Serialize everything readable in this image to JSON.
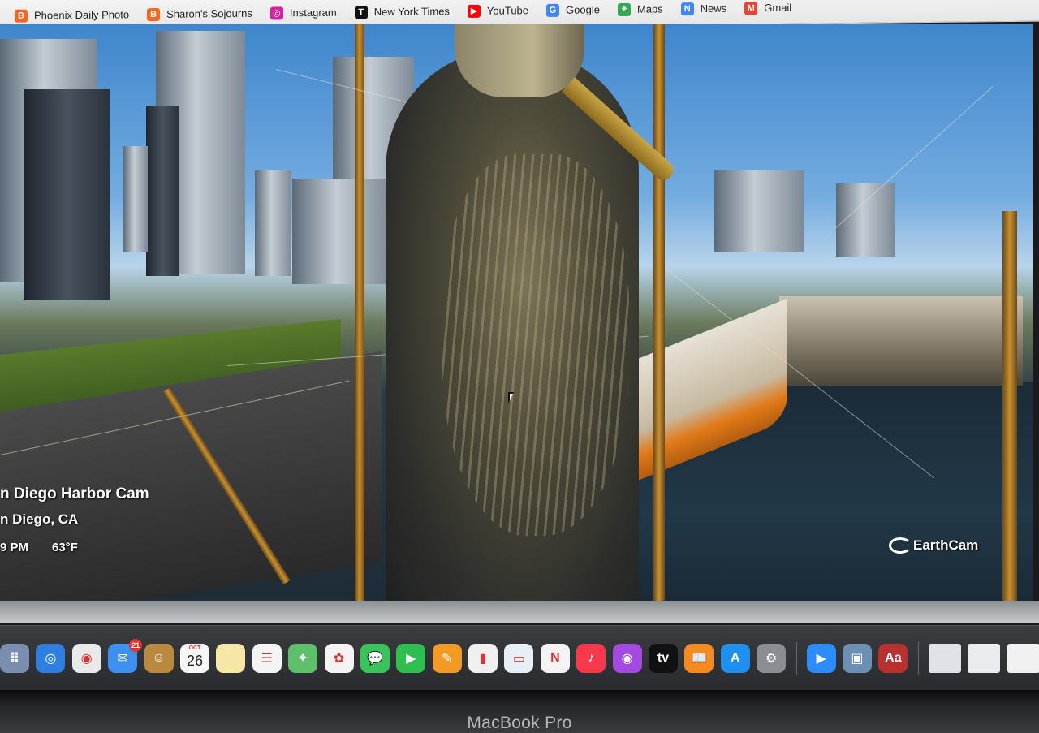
{
  "bookmarks": [
    {
      "label": "Phoenix Daily Photo",
      "icon": "blogger-icon",
      "color": "#f26722",
      "glyph": "B"
    },
    {
      "label": "Sharon's Sojourns",
      "icon": "blogger-icon",
      "color": "#f26722",
      "glyph": "B"
    },
    {
      "label": "Instagram",
      "icon": "instagram-icon",
      "color": "#d6249f",
      "glyph": "◎"
    },
    {
      "label": "New York Times",
      "icon": "nyt-icon",
      "color": "#111111",
      "glyph": "T"
    },
    {
      "label": "YouTube",
      "icon": "youtube-icon",
      "color": "#ff0000",
      "glyph": "▶"
    },
    {
      "label": "Google",
      "icon": "google-icon",
      "color": "#4285f4",
      "glyph": "G"
    },
    {
      "label": "Maps",
      "icon": "maps-icon",
      "color": "#34a853",
      "glyph": "⌖"
    },
    {
      "label": "News",
      "icon": "news-icon",
      "color": "#4285f4",
      "glyph": "N"
    },
    {
      "label": "Gmail",
      "icon": "gmail-icon",
      "color": "#ea4335",
      "glyph": "M"
    }
  ],
  "video": {
    "title": "n Diego Harbor Cam",
    "location": "n Diego, CA",
    "time": "9 PM",
    "temperature": "63°F",
    "brand": "EarthCam"
  },
  "dock": {
    "apps": [
      {
        "name": "launchpad",
        "color": "#7a8fb0",
        "glyph": "⠿"
      },
      {
        "name": "safari",
        "color": "#2f7fe0",
        "glyph": "◎"
      },
      {
        "name": "chrome",
        "color": "#e9e9e9",
        "glyph": "◉"
      },
      {
        "name": "mail",
        "color": "#3d8ff0",
        "glyph": "✉",
        "badge": "21"
      },
      {
        "name": "contacts",
        "color": "#b8893f",
        "glyph": "☺"
      },
      {
        "name": "calendar",
        "color": "#f7f7f7",
        "month": "OCT",
        "day": "26"
      },
      {
        "name": "notes",
        "color": "#f6e7a7",
        "glyph": ""
      },
      {
        "name": "reminders",
        "color": "#f4f4f4",
        "glyph": "☰"
      },
      {
        "name": "maps",
        "color": "#5fbf6a",
        "glyph": "⌖"
      },
      {
        "name": "photos",
        "color": "#f4f4f4",
        "glyph": "✿"
      },
      {
        "name": "messages",
        "color": "#39c35a",
        "glyph": "💬"
      },
      {
        "name": "facetime",
        "color": "#2fbf4f",
        "glyph": "▶"
      },
      {
        "name": "pages",
        "color": "#f39a25",
        "glyph": "✎"
      },
      {
        "name": "numbers",
        "color": "#f0f0f0",
        "glyph": "▮"
      },
      {
        "name": "keynote",
        "color": "#e8eef6",
        "glyph": "▭"
      },
      {
        "name": "news",
        "color": "#f4f4f4",
        "glyph": "N"
      },
      {
        "name": "music",
        "color": "#f8394c",
        "glyph": "♪"
      },
      {
        "name": "podcasts",
        "color": "#a44ae0",
        "glyph": "◉"
      },
      {
        "name": "tv",
        "color": "#111111",
        "glyph": "tv"
      },
      {
        "name": "books",
        "color": "#f58a1f",
        "glyph": "📖"
      },
      {
        "name": "app-store",
        "color": "#1f8ff0",
        "glyph": "A"
      },
      {
        "name": "system-preferences",
        "color": "#8b8d92",
        "glyph": "⚙"
      },
      {
        "name": "zoom",
        "color": "#2d8cff",
        "glyph": "▶"
      },
      {
        "name": "preview",
        "color": "#6d8fb3",
        "glyph": "▣"
      },
      {
        "name": "dictionary",
        "color": "#b8312f",
        "glyph": "Aa"
      }
    ],
    "recents": [
      {
        "name": "recent-window-1",
        "color": "#dfe3e8"
      },
      {
        "name": "recent-window-2",
        "color": "#e9ecef"
      },
      {
        "name": "recent-window-3",
        "color": "#f1f1f1"
      }
    ]
  },
  "bezel_label": "MacBook Pro"
}
